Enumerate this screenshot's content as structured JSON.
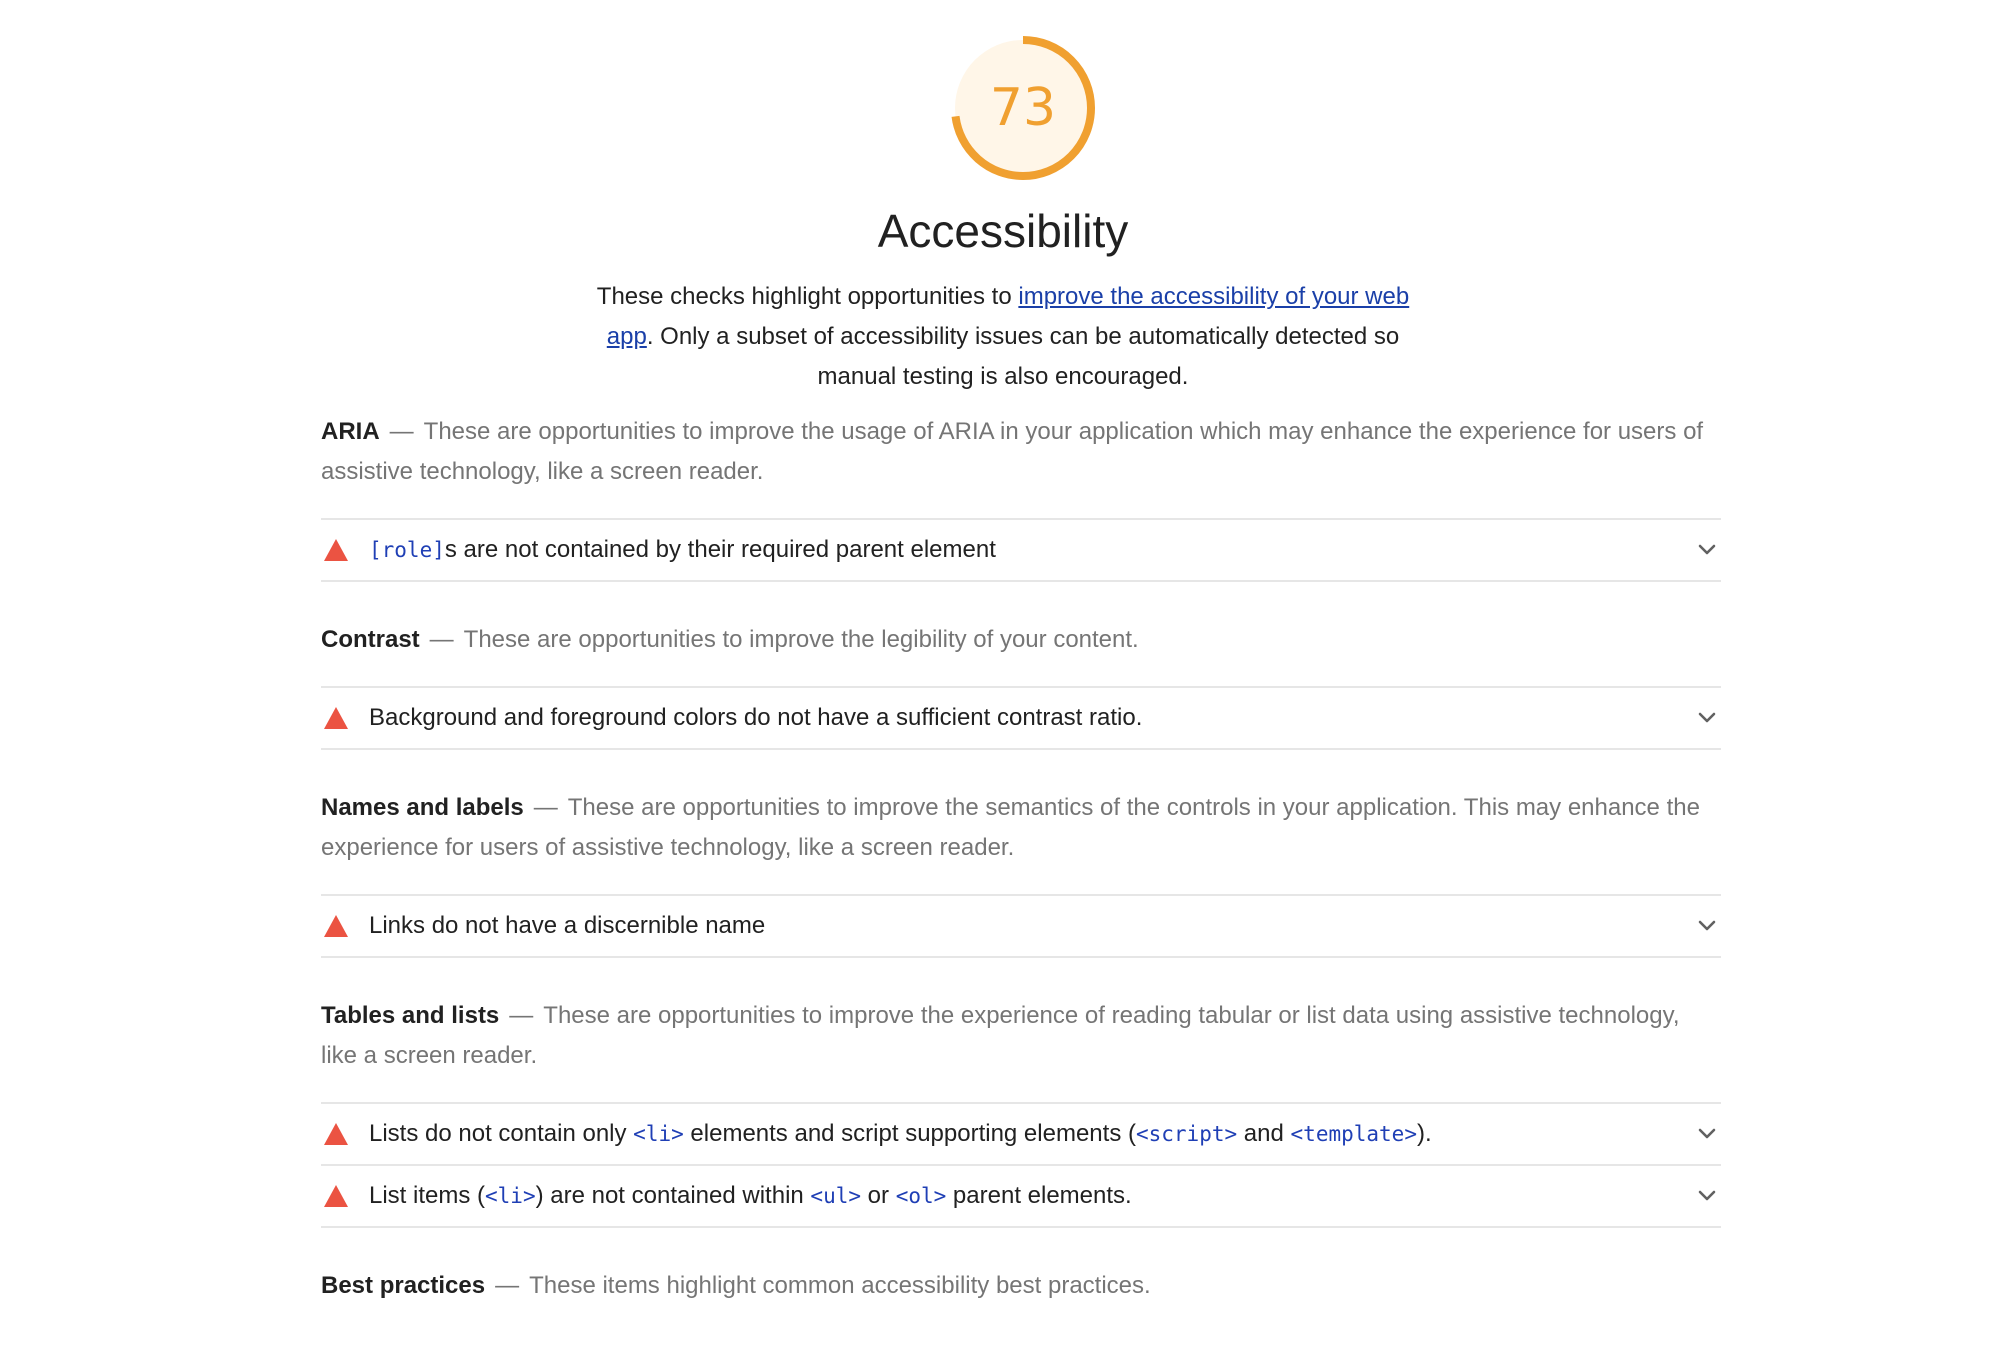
{
  "score": {
    "value": "73",
    "fraction": 0.73,
    "color": "#f0a030",
    "fill": "#fff6e8"
  },
  "category": {
    "title": "Accessibility",
    "desc_before": "These checks highlight opportunities to ",
    "desc_link": "improve the accessibility of your web app",
    "desc_after": ". Only a subset of accessibility issues can be automatically detected so manual testing is also encouraged."
  },
  "groups": [
    {
      "name": "ARIA",
      "desc": "These are opportunities to improve the usage of ARIA in your application which may enhance the experience for users of assistive technology, like a screen reader.",
      "audits": [
        {
          "parts": [
            {
              "code": "[role]"
            },
            {
              "text": "s are not contained by their required parent element"
            }
          ]
        }
      ]
    },
    {
      "name": "Contrast",
      "desc": "These are opportunities to improve the legibility of your content.",
      "audits": [
        {
          "parts": [
            {
              "text": "Background and foreground colors do not have a sufficient contrast ratio."
            }
          ]
        }
      ]
    },
    {
      "name": "Names and labels",
      "desc": "These are opportunities to improve the semantics of the controls in your application. This may enhance the experience for users of assistive technology, like a screen reader.",
      "audits": [
        {
          "parts": [
            {
              "text": "Links do not have a discernible name"
            }
          ]
        }
      ]
    },
    {
      "name": "Tables and lists",
      "desc": "These are opportunities to improve the experience of reading tabular or list data using assistive technology, like a screen reader.",
      "audits": [
        {
          "parts": [
            {
              "text": "Lists do not contain only "
            },
            {
              "code": "<li>"
            },
            {
              "text": " elements and script supporting elements ("
            },
            {
              "code": "<script>"
            },
            {
              "text": " and "
            },
            {
              "code": "<template>"
            },
            {
              "text": ")."
            }
          ]
        },
        {
          "parts": [
            {
              "text": "List items ("
            },
            {
              "code": "<li>"
            },
            {
              "text": ") are not contained within "
            },
            {
              "code": "<ul>"
            },
            {
              "text": " or "
            },
            {
              "code": "<ol>"
            },
            {
              "text": " parent elements."
            }
          ]
        }
      ]
    },
    {
      "name": "Best practices",
      "desc": "These items highlight common accessibility best practices.",
      "audits": []
    }
  ],
  "icons": {
    "fail": "red-triangle-fail-icon",
    "expand": "chevron-down-icon",
    "fail_color": "#eb5342",
    "link_color": "#1a3fa8",
    "code_color": "#1f3fb5"
  }
}
